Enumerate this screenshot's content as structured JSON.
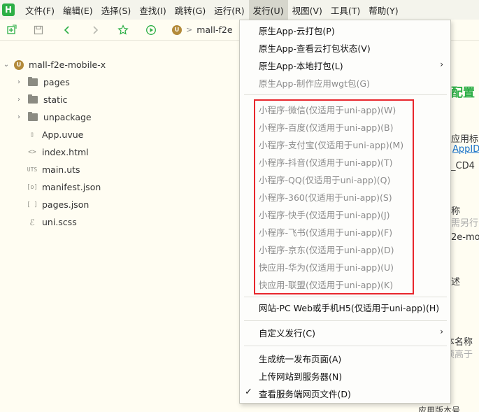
{
  "menubar": {
    "logo": "H",
    "items": [
      "文件(F)",
      "编辑(E)",
      "选择(S)",
      "查找(I)",
      "跳转(G)",
      "运行(R)",
      "发行(U)",
      "视图(V)",
      "工具(T)",
      "帮助(Y)"
    ]
  },
  "toolbar": {
    "crumb_badge": "U",
    "crumb_label": "mall-f2e"
  },
  "tree": {
    "project": "mall-f2e-mobile-x",
    "project_badge": "U",
    "items": [
      {
        "label": "pages",
        "kind": "folder"
      },
      {
        "label": "static",
        "kind": "folder"
      },
      {
        "label": "unpackage",
        "kind": "folder"
      },
      {
        "label": "App.uvue",
        "kind": "file",
        "icon_text": "▯"
      },
      {
        "label": "index.html",
        "kind": "file",
        "icon_text": "<>"
      },
      {
        "label": "main.uts",
        "kind": "file",
        "icon_text": "UTS"
      },
      {
        "label": "manifest.json",
        "kind": "file",
        "icon_text": "[o]"
      },
      {
        "label": "pages.json",
        "kind": "file",
        "icon_text": "[ ]"
      },
      {
        "label": "uni.scss",
        "kind": "file",
        "icon_text": "ℰ"
      }
    ]
  },
  "editor": {
    "heading": "配置",
    "line1": "应用标",
    "line2": "AppID",
    "line3": "_CD4",
    "line4": "称",
    "line5": "需另行",
    "line6": "2e-mo",
    "line7": "述",
    "line8": "本名称",
    "line9": "须高于",
    "line10": "应用版本号"
  },
  "dropdown": {
    "group1": [
      {
        "label": "原生App-云打包(P)",
        "disabled": false
      },
      {
        "label": "原生App-查看云打包状态(V)",
        "disabled": false
      },
      {
        "label": "原生App-本地打包(L)",
        "disabled": false,
        "submenu": true
      },
      {
        "label": "原生App-制作应用wgt包(G)",
        "disabled": true
      }
    ],
    "group2": [
      {
        "label": "小程序-微信(仅适用于uni-app)(W)"
      },
      {
        "label": "小程序-百度(仅适用于uni-app)(B)"
      },
      {
        "label": "小程序-支付宝(仅适用于uni-app)(M)"
      },
      {
        "label": "小程序-抖音(仅适用于uni-app)(T)"
      },
      {
        "label": "小程序-QQ(仅适用于uni-app)(Q)"
      },
      {
        "label": "小程序-360(仅适用于uni-app)(S)"
      },
      {
        "label": "小程序-快手(仅适用于uni-app)(J)"
      },
      {
        "label": "小程序-飞书(仅适用于uni-app)(F)"
      },
      {
        "label": "小程序-京东(仅适用于uni-app)(D)"
      },
      {
        "label": "快应用-华为(仅适用于uni-app)(U)"
      },
      {
        "label": "快应用-联盟(仅适用于uni-app)(K)"
      }
    ],
    "web": "网站-PC Web或手机H5(仅适用于uni-app)(H)",
    "custom": "自定义发行(C)",
    "publish_page": "生成统一发布页面(A)",
    "upload": "上传网站到服务器(N)",
    "view_server": "查看服务端网页文件(D)"
  },
  "colors": {
    "highlight": "#e8262c",
    "brand_green": "#2bae45",
    "link_blue": "#1a73c9"
  }
}
